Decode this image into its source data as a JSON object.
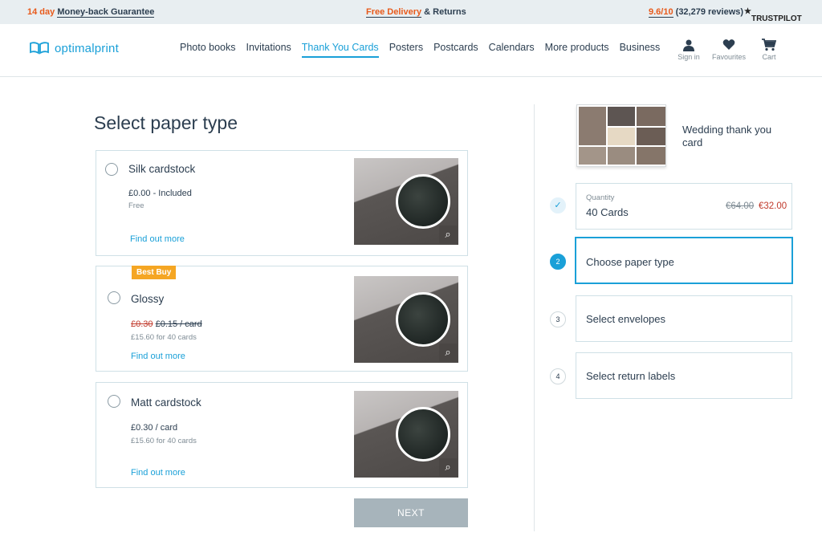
{
  "topbar": {
    "left_accent": "14 day",
    "left_text": "Money-back Guarantee",
    "center_accent": "Free Delivery",
    "center_text": "& Returns",
    "right_accent": "9.6/10",
    "right_text": "(32,279 reviews)",
    "trustpilot": "TRUSTPILOT"
  },
  "header": {
    "logo_text": "optimalprint",
    "nav": [
      {
        "label": "Photo books"
      },
      {
        "label": "Invitations"
      },
      {
        "label": "Thank You Cards",
        "active": true
      },
      {
        "label": "Posters"
      },
      {
        "label": "Postcards"
      },
      {
        "label": "Calendars"
      },
      {
        "label": "More products"
      },
      {
        "label": "Business"
      }
    ],
    "account": [
      {
        "label": "Sign in",
        "icon": "user-icon"
      },
      {
        "label": "Favourites",
        "icon": "heart-icon"
      },
      {
        "label": "Cart",
        "icon": "cart-icon"
      }
    ]
  },
  "main": {
    "title": "Select paper type",
    "options": [
      {
        "name": "Silk cardstock",
        "price": "£0.00 - Included",
        "sub": "Free",
        "link": "Find out more"
      },
      {
        "name": "Glossy",
        "badge": "Best Buy",
        "price_old": "£0.30",
        "price_new": "£0.15 / card",
        "sub": "£15.60 for 40 cards",
        "link": "Find out more"
      },
      {
        "name": "Matt cardstock",
        "price": "£0.30 / card",
        "sub": "£15.60 for 40 cards",
        "link": "Find out more"
      }
    ],
    "next_label": "NEXT"
  },
  "sidebar": {
    "product_name": "Wedding thank you card",
    "steps": [
      {
        "num": "✓",
        "quantity_label": "Quantity",
        "quantity_value": "40 Cards",
        "price_old": "€64.00",
        "price_new": "€32.00"
      },
      {
        "num": "2",
        "label": "Choose paper type"
      },
      {
        "num": "3",
        "label": "Select envelopes"
      },
      {
        "num": "4",
        "label": "Select return labels"
      }
    ]
  },
  "colors": {
    "accent": "#1aa0d8",
    "orange": "#e85a1b",
    "badge": "#f5a623",
    "sale": "#c0392b"
  }
}
